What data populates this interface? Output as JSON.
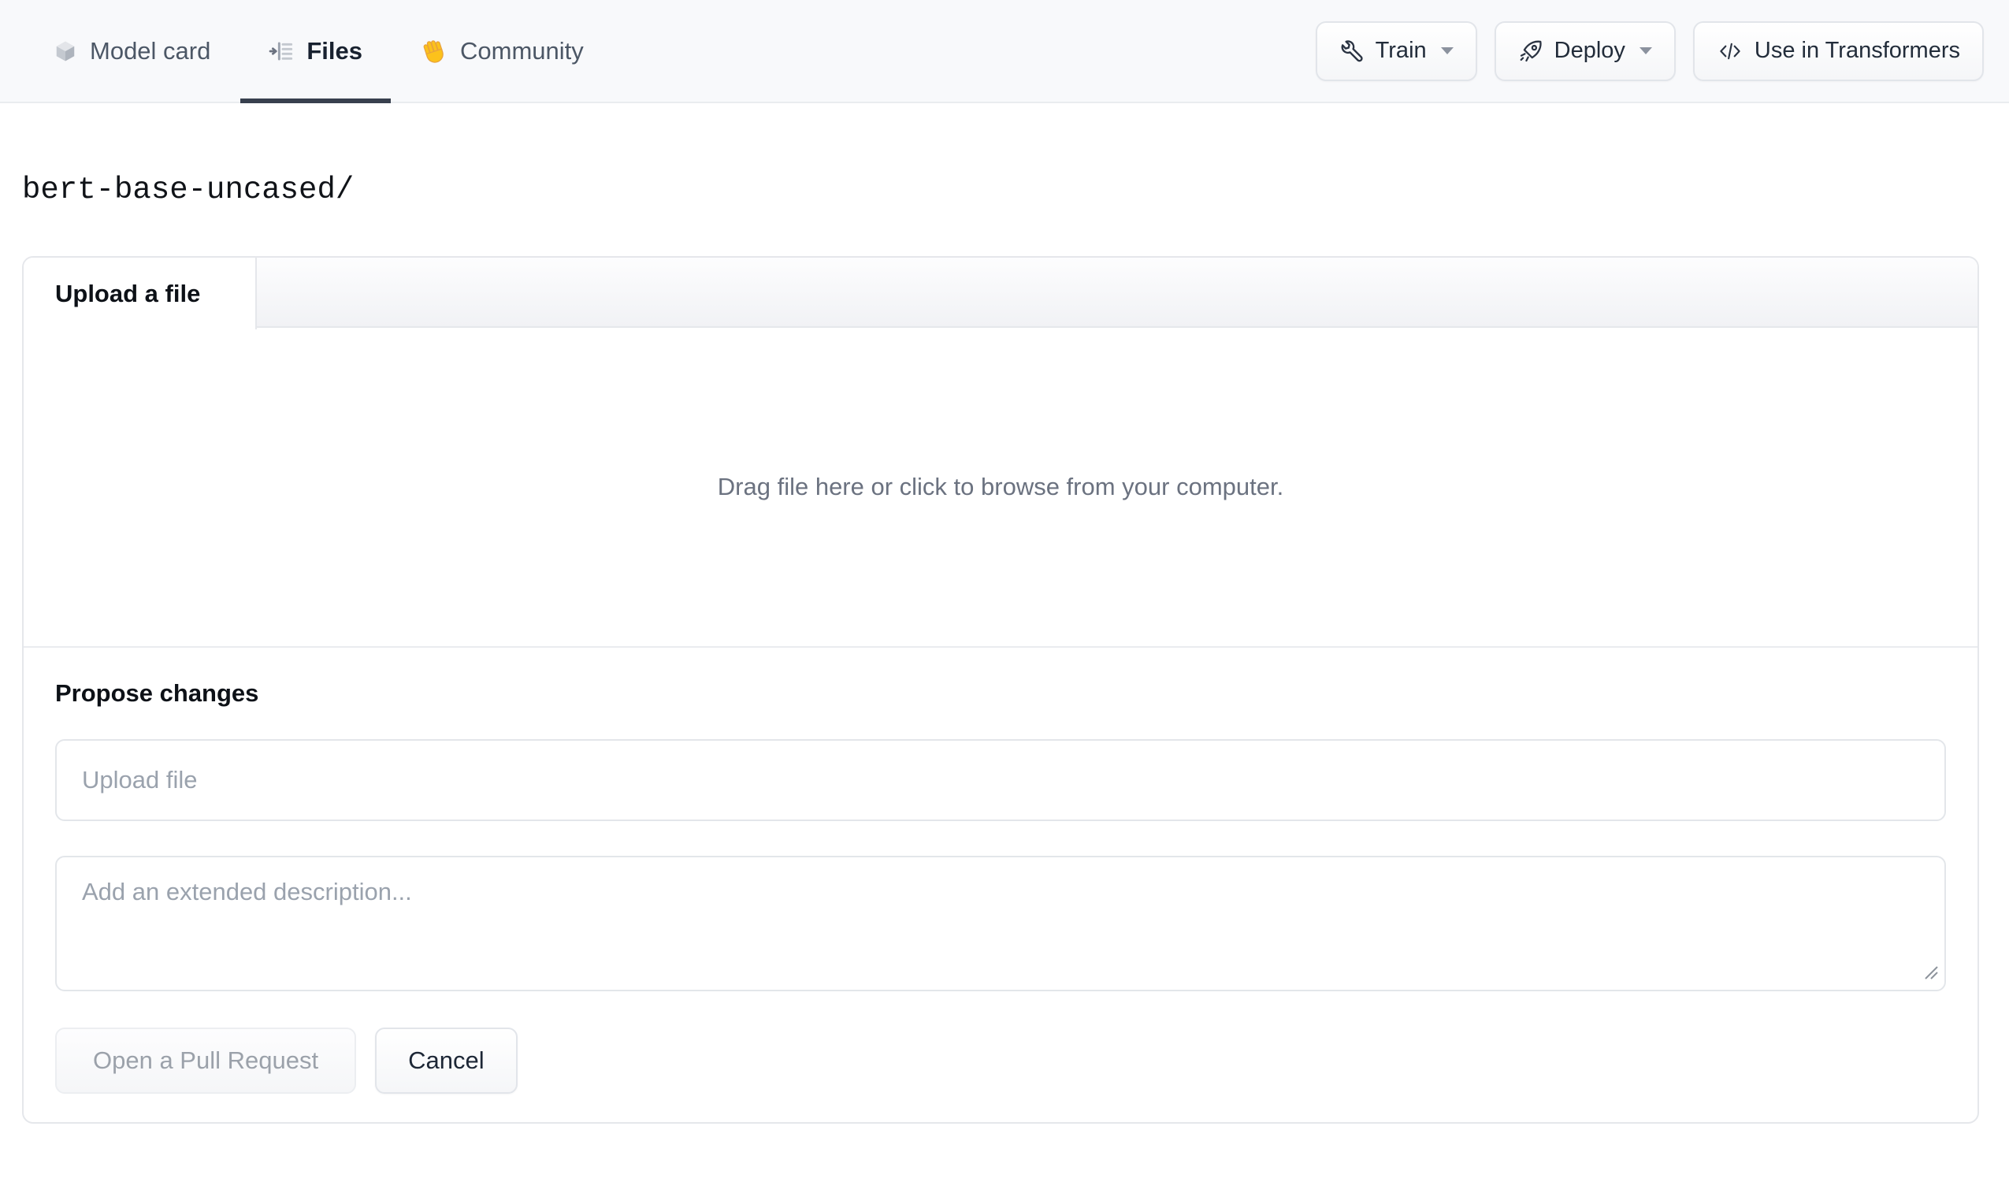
{
  "nav": {
    "tabs": [
      {
        "label": "Model card",
        "icon": "cube-icon",
        "active": false
      },
      {
        "label": "Files",
        "icon": "file-versions-icon",
        "active": true
      },
      {
        "label": "Community",
        "icon": "waving-hand-icon",
        "active": false
      }
    ],
    "actions": [
      {
        "label": "Train",
        "icon": "wrench-icon",
        "has_dropdown": true
      },
      {
        "label": "Deploy",
        "icon": "rocket-icon",
        "has_dropdown": true
      },
      {
        "label": "Use in Transformers",
        "icon": "code-icon",
        "has_dropdown": false
      }
    ]
  },
  "breadcrumb": {
    "path": "bert-base-uncased/"
  },
  "upload_card": {
    "tab_label": "Upload a file",
    "dropzone_text": "Drag file here or click to browse from your computer.",
    "propose": {
      "title": "Propose changes",
      "filename_placeholder": "Upload file",
      "description_value": "",
      "description_placeholder": "Add an extended description...",
      "submit_label": "Open a Pull Request",
      "submit_enabled": false,
      "cancel_label": "Cancel"
    }
  },
  "colors": {
    "nav_background": "#f8f9fb",
    "active_tab_underline": "#38404e",
    "border": "#e5e7eb",
    "text_dark": "#18212f",
    "text_muted": "#6b7280",
    "placeholder": "#9aa2ad",
    "hand_emoji_yellow": "#fcc21b"
  }
}
